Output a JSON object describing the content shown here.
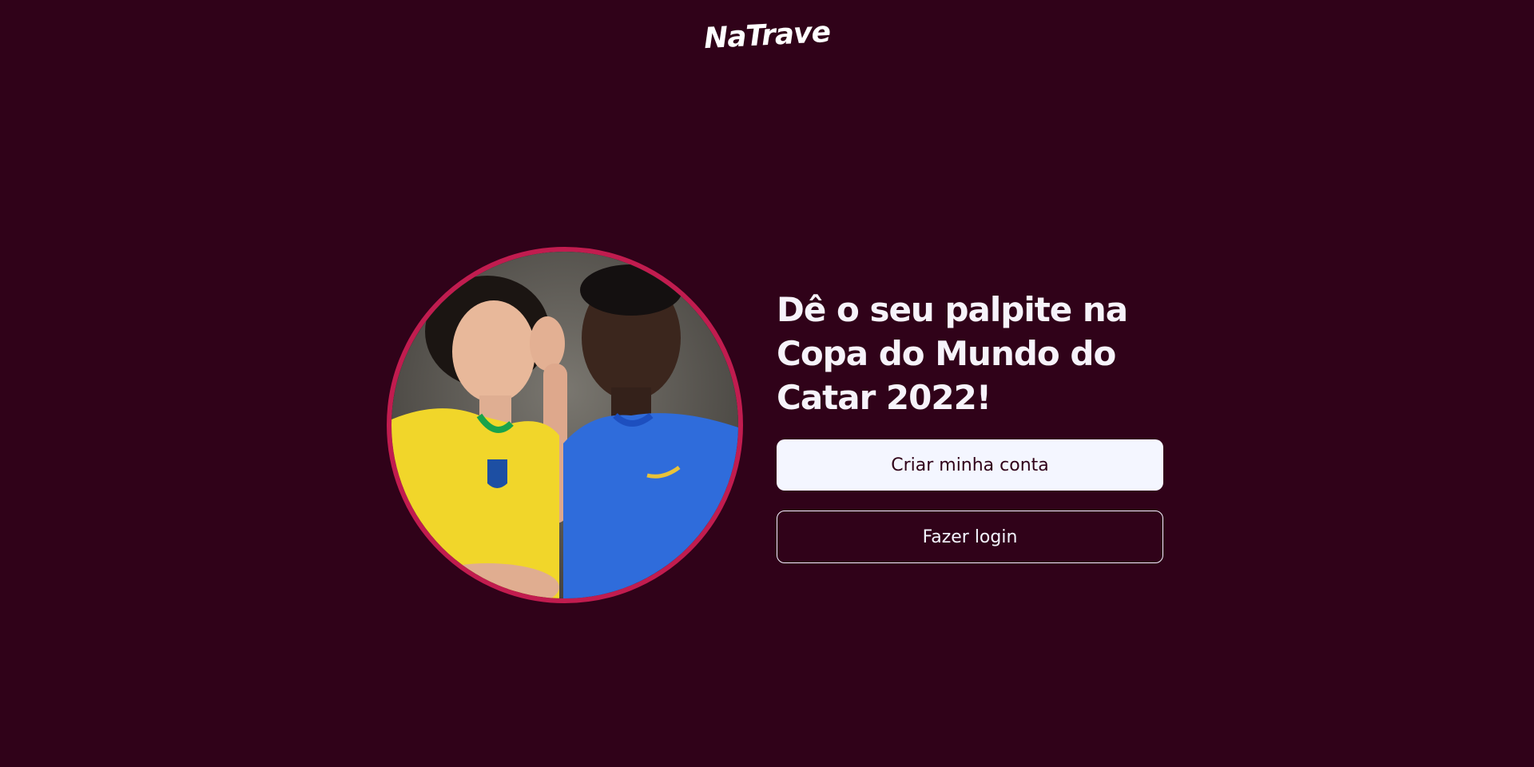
{
  "header": {
    "logo_text": "NaTrave"
  },
  "hero": {
    "image_alt": "Two people wearing Brazil national team jerseys",
    "headline": "Dê o seu palpite na Copa do Mundo do Catar 2022!",
    "create_account_label": "Criar minha conta",
    "login_label": "Fazer login"
  },
  "colors": {
    "background": "#300219",
    "accent_border": "#c11c4f",
    "button_light": "#f4f6ff"
  }
}
